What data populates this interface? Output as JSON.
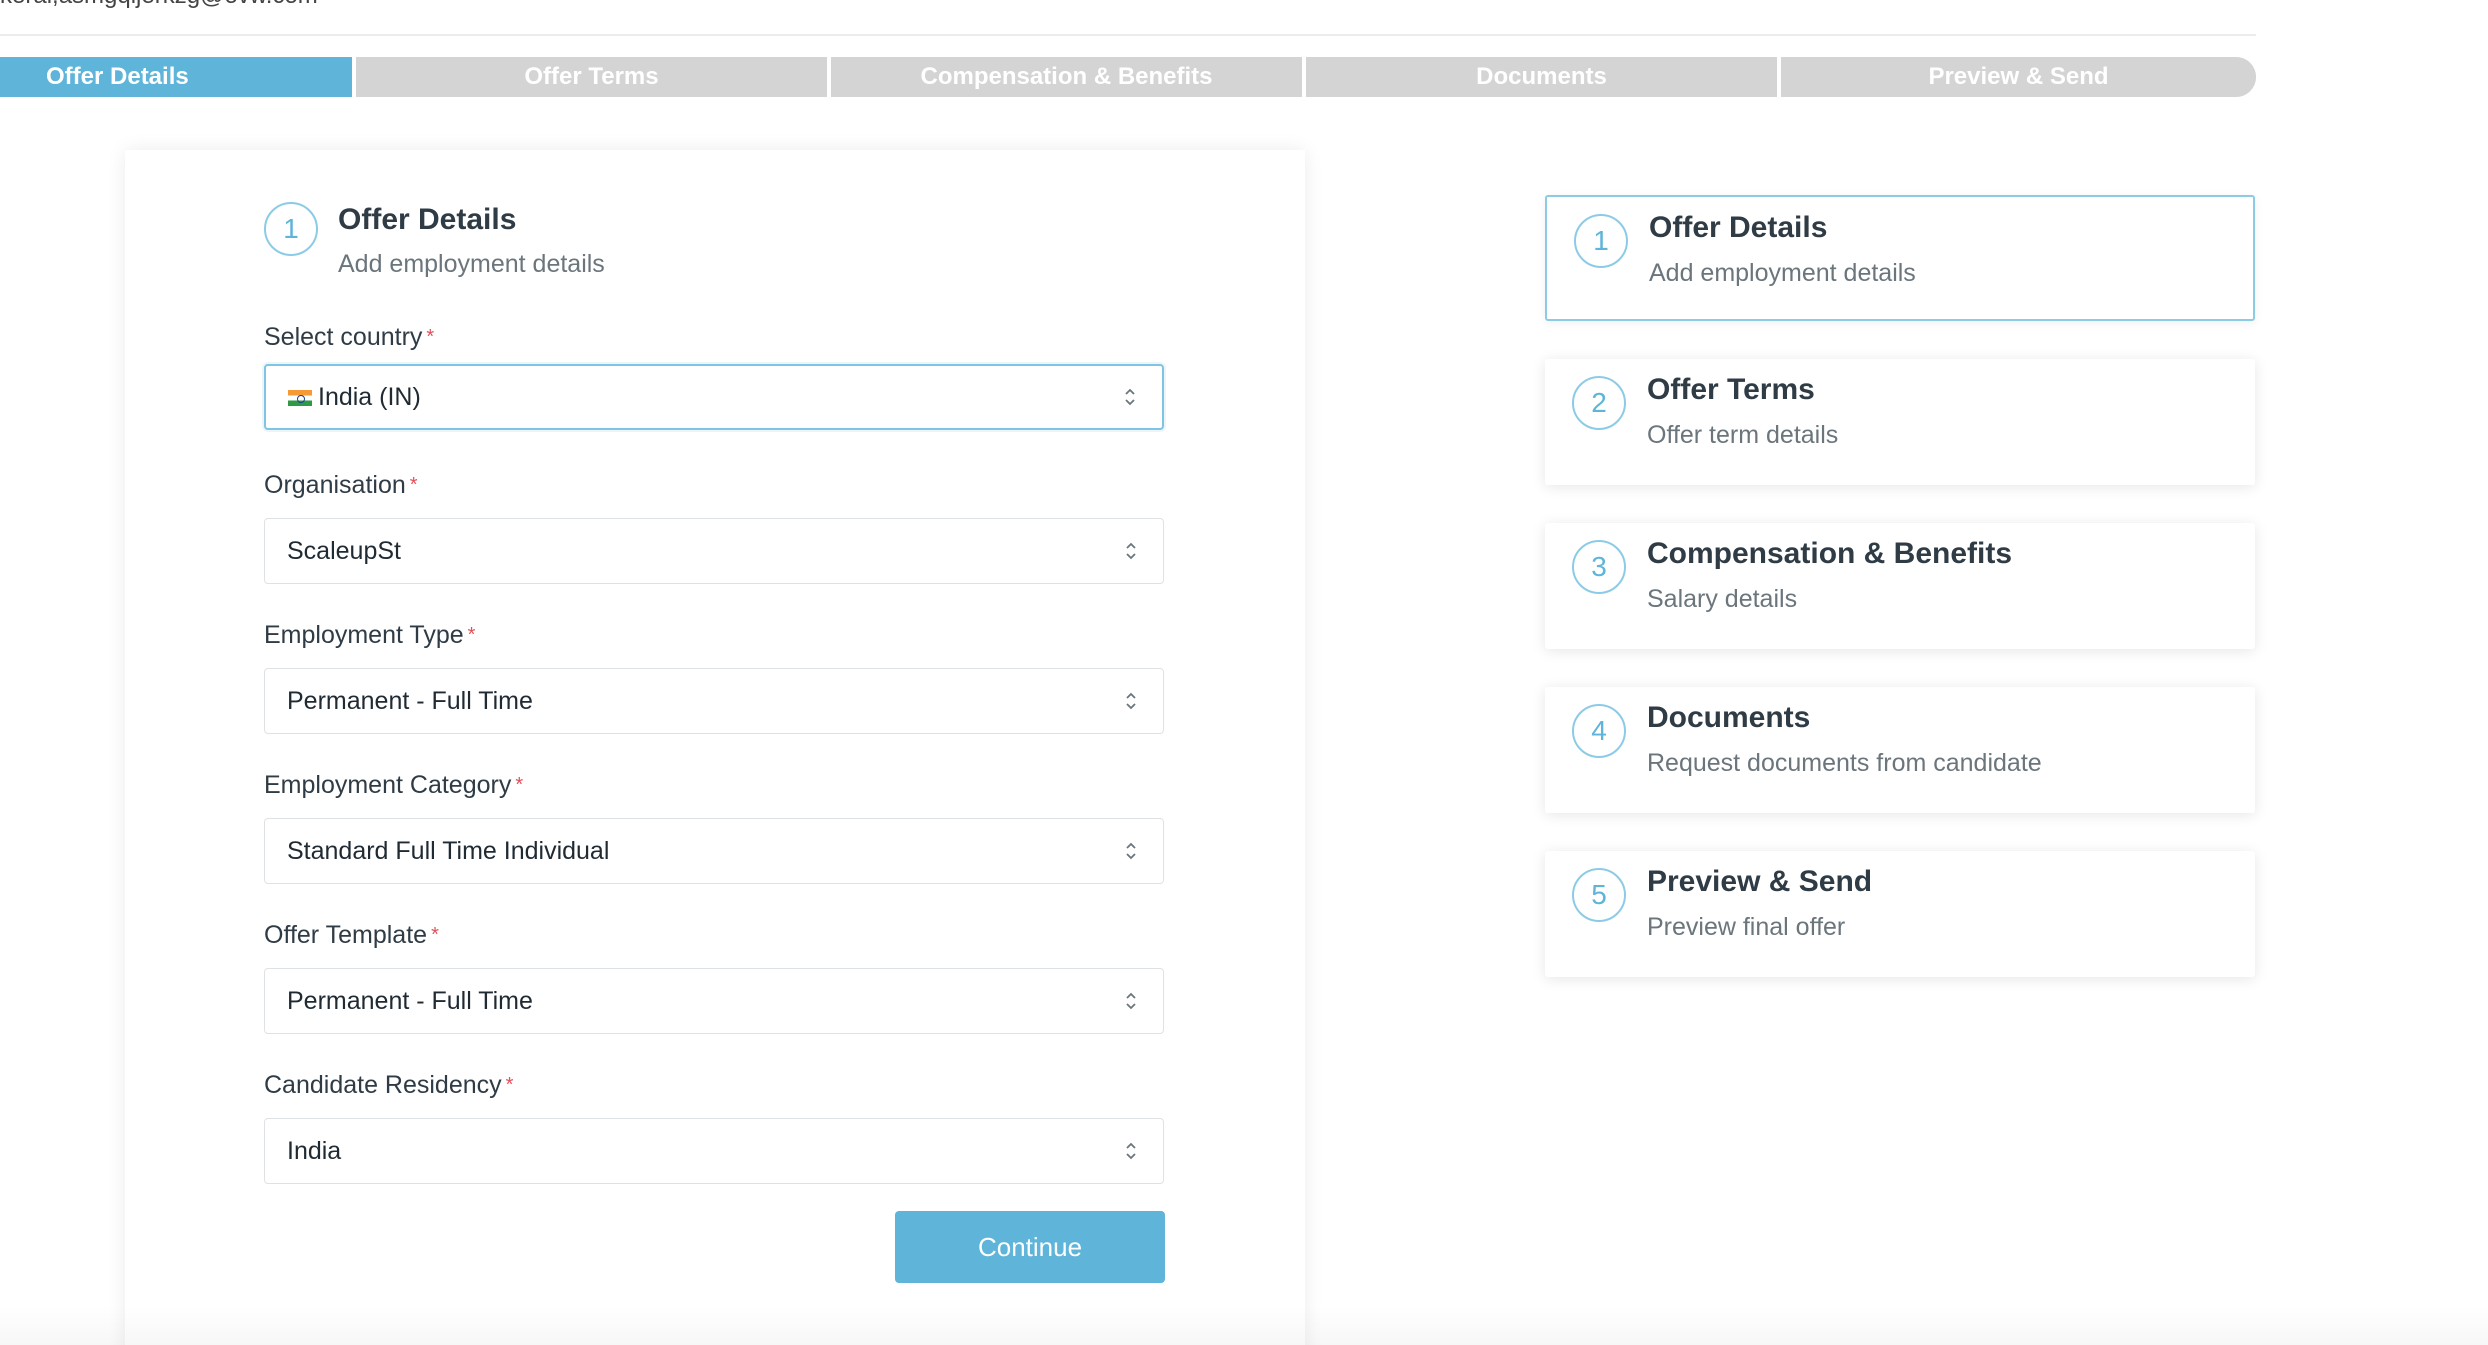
{
  "top": {
    "email_fragment": "kerai,asmgqijerkzg@ovw.com"
  },
  "progress": {
    "steps": [
      "Offer Details",
      "Offer Terms",
      "Compensation & Benefits",
      "Documents",
      "Preview & Send"
    ],
    "active_index": 0,
    "colors": {
      "active": "#5fb4d9",
      "inactive": "#d4d4d4"
    }
  },
  "form": {
    "step_number": "1",
    "title": "Offer Details",
    "subtitle": "Add employment details",
    "required_marker": "*",
    "fields": [
      {
        "label": "Select country",
        "value": "India (IN)",
        "icon": "india-flag-icon"
      },
      {
        "label": "Organisation",
        "value": "ScaleupSt"
      },
      {
        "label": "Employment Type",
        "value": "Permanent - Full Time"
      },
      {
        "label": "Employment Category",
        "value": "Standard Full Time Individual"
      },
      {
        "label": "Offer Template",
        "value": "Permanent - Full Time"
      },
      {
        "label": "Candidate Residency",
        "value": "India"
      }
    ],
    "continue_label": "Continue"
  },
  "sidebar": {
    "steps": [
      {
        "number": "1",
        "title": "Offer Details",
        "subtitle": "Add employment details",
        "active": true
      },
      {
        "number": "2",
        "title": "Offer Terms",
        "subtitle": "Offer term details",
        "active": false
      },
      {
        "number": "3",
        "title": "Compensation & Benefits",
        "subtitle": "Salary details",
        "active": false
      },
      {
        "number": "4",
        "title": "Documents",
        "subtitle": "Request documents from candidate",
        "active": false
      },
      {
        "number": "5",
        "title": "Preview & Send",
        "subtitle": "Preview final offer",
        "active": false
      }
    ]
  }
}
